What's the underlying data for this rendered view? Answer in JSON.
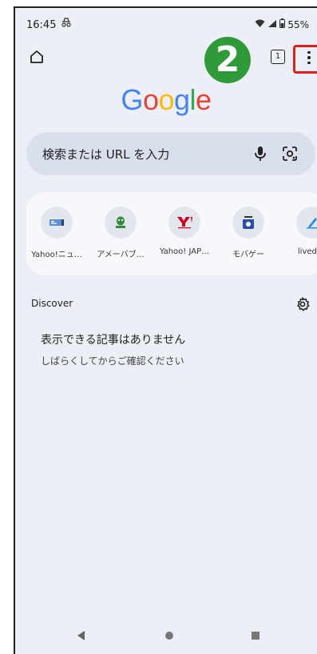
{
  "status": {
    "time": "16:45",
    "battery": "55%"
  },
  "annotation": {
    "step": "2"
  },
  "toolbar": {
    "tab_count": "1"
  },
  "brand": {
    "letters": [
      "G",
      "o",
      "o",
      "g",
      "l",
      "e"
    ],
    "colors": [
      "#4285F4",
      "#EA4335",
      "#FBBC05",
      "#4285F4",
      "#34A853",
      "#EA4335"
    ]
  },
  "search": {
    "placeholder": "検索または URL を入力"
  },
  "shortcuts": [
    {
      "label": "Yahoo!ニュ…",
      "icon": "yahoo-news-icon"
    },
    {
      "label": "アメーバブ…",
      "icon": "ameba-icon"
    },
    {
      "label": "Yahoo! JAP…",
      "icon": "yahoo-japan-icon"
    },
    {
      "label": "モバゲー",
      "icon": "mobage-icon"
    },
    {
      "label": "livedoo",
      "icon": "livedoor-icon"
    }
  ],
  "discover": {
    "label": "Discover",
    "empty_title": "表示できる記事はありません",
    "empty_subtitle": "しばらくしてからご確認ください"
  },
  "colors": {
    "highlight": "#e0201b",
    "badge": "#2e9b38",
    "page_background": "#edeff6"
  }
}
